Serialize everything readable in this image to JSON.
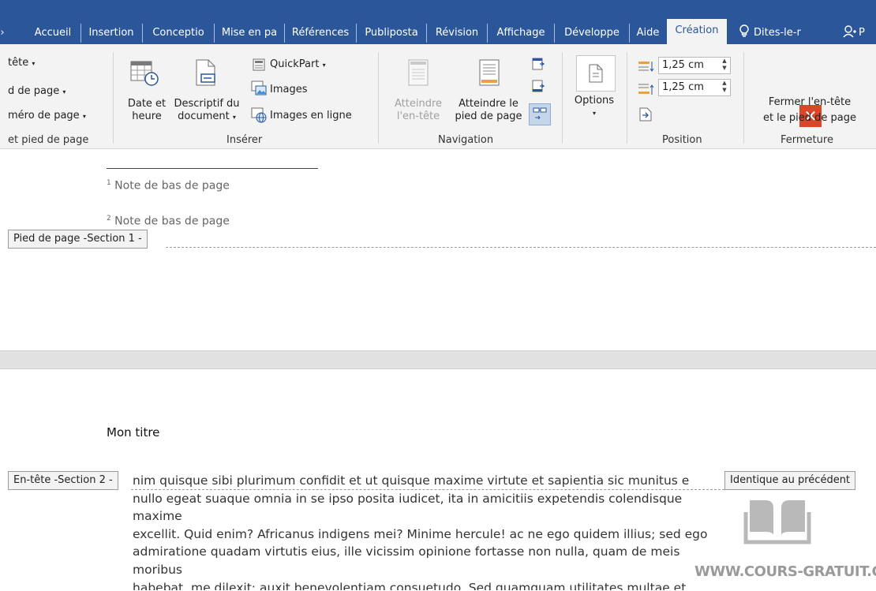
{
  "tabs": {
    "accueil": "Accueil",
    "insertion": "Insertion",
    "conception": "Conceptio",
    "mise_en_page": "Mise en pa",
    "references": "Références",
    "publipostage": "Publiposta",
    "revision": "Révision",
    "affichage": "Affichage",
    "developpeur": "Développe",
    "aide": "Aide",
    "creation": "Création",
    "tell_me": "Dites-le-r",
    "share": "P"
  },
  "ribbon": {
    "header_footer": {
      "entete": "tête",
      "pied_de_page": "d de page",
      "numero_de_page": "méro de page",
      "group_label": "et pied de page"
    },
    "inserer": {
      "date_et_heure_1": "Date et",
      "date_et_heure_2": "heure",
      "descriptif_1": "Descriptif du",
      "descriptif_2": "document",
      "quickpart": "QuickPart",
      "images": "Images",
      "images_en_ligne": "Images en ligne",
      "group_label": "Insérer"
    },
    "navigation": {
      "atteindre_entete_1": "Atteindre",
      "atteindre_entete_2": "l'en-tête",
      "atteindre_pied_1": "Atteindre le",
      "atteindre_pied_2": "pied de page",
      "group_label": "Navigation"
    },
    "options": {
      "label": "Options"
    },
    "position": {
      "header_value": "1,25 cm",
      "footer_value": "1,25 cm",
      "group_label": "Position"
    },
    "fermeture": {
      "close_1": "Fermer l'en-tête",
      "close_2": "et le pied de page",
      "group_label": "Fermeture"
    }
  },
  "document": {
    "footnote1_num": "1",
    "footnote1_text": " Note de bas de page",
    "footnote2_num": "2",
    "footnote2_text": " Note de bas de page",
    "footer_tag": "Pied de page -Section 1 -",
    "title": "Mon titre",
    "header_tag": "En-tête -Section 2 -",
    "same_as_previous": "Identique au précédent",
    "paragraph": "nim quisque sibi plurimum confidit et ut quisque maxime virtute et sapientia sic munitus e\nnullo egeat suaque omnia in se ipso posita iudicet, ita in amicitiis expetendis colendisque maxime\nexcellit. Quid enim? Africanus indigens mei? Minime hercule! ac ne ego quidem illius; sed ego\nadmiratione quadam virtutis eius, ille vicissim opinione fortasse non nulla, quam de meis moribus\nhabebat, me dilexit; auxit benevolentiam consuetudo. Sed quamquam utilitates multae et magnae\nconsecutae sunt, non sunt tamen ab earum spe causae diligendi profectae.",
    "watermark": "WWW.COURS-GRATUIT.COM"
  },
  "colors": {
    "ribbon_blue": "#2b579a",
    "ribbon_bg": "#f3f3f3",
    "close_red": "#d9472b"
  }
}
